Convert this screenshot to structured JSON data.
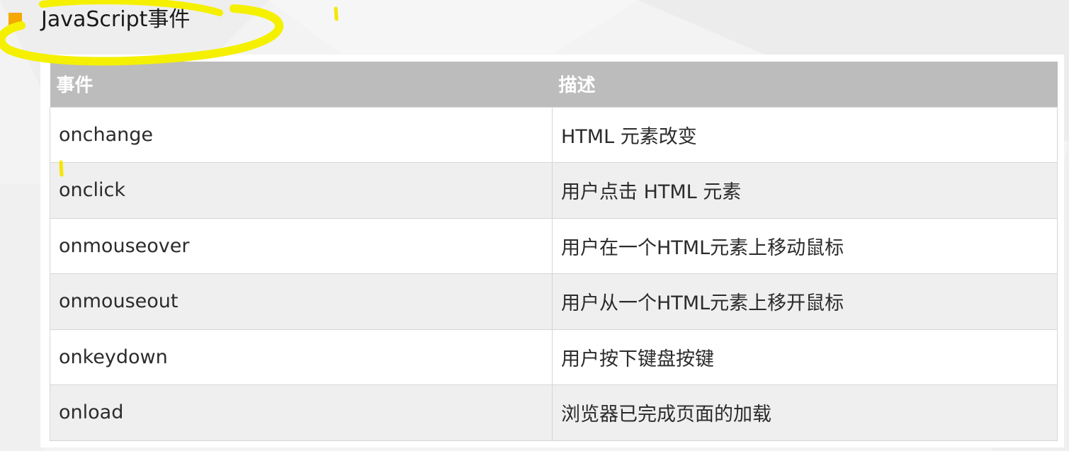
{
  "slide": {
    "title": "JavaScript事件",
    "accent_color": "#f5a800",
    "annotation_color": "#f5f000",
    "bullet_icon": "square-bullet-icon"
  },
  "table": {
    "headers": [
      "事件",
      "描述"
    ],
    "rows": [
      [
        "onchange",
        "HTML 元素改变"
      ],
      [
        "onclick",
        "用户点击 HTML 元素"
      ],
      [
        "onmouseover",
        "用户在一个HTML元素上移动鼠标"
      ],
      [
        "onmouseout",
        "用户从一个HTML元素上移开鼠标"
      ],
      [
        "onkeydown",
        "用户按下键盘按键"
      ],
      [
        "onload",
        "浏览器已完成页面的加载"
      ]
    ],
    "header_bg": "#bcbcbc",
    "header_text_color": "#ffffff",
    "row_alt_bg": "#efefef"
  }
}
